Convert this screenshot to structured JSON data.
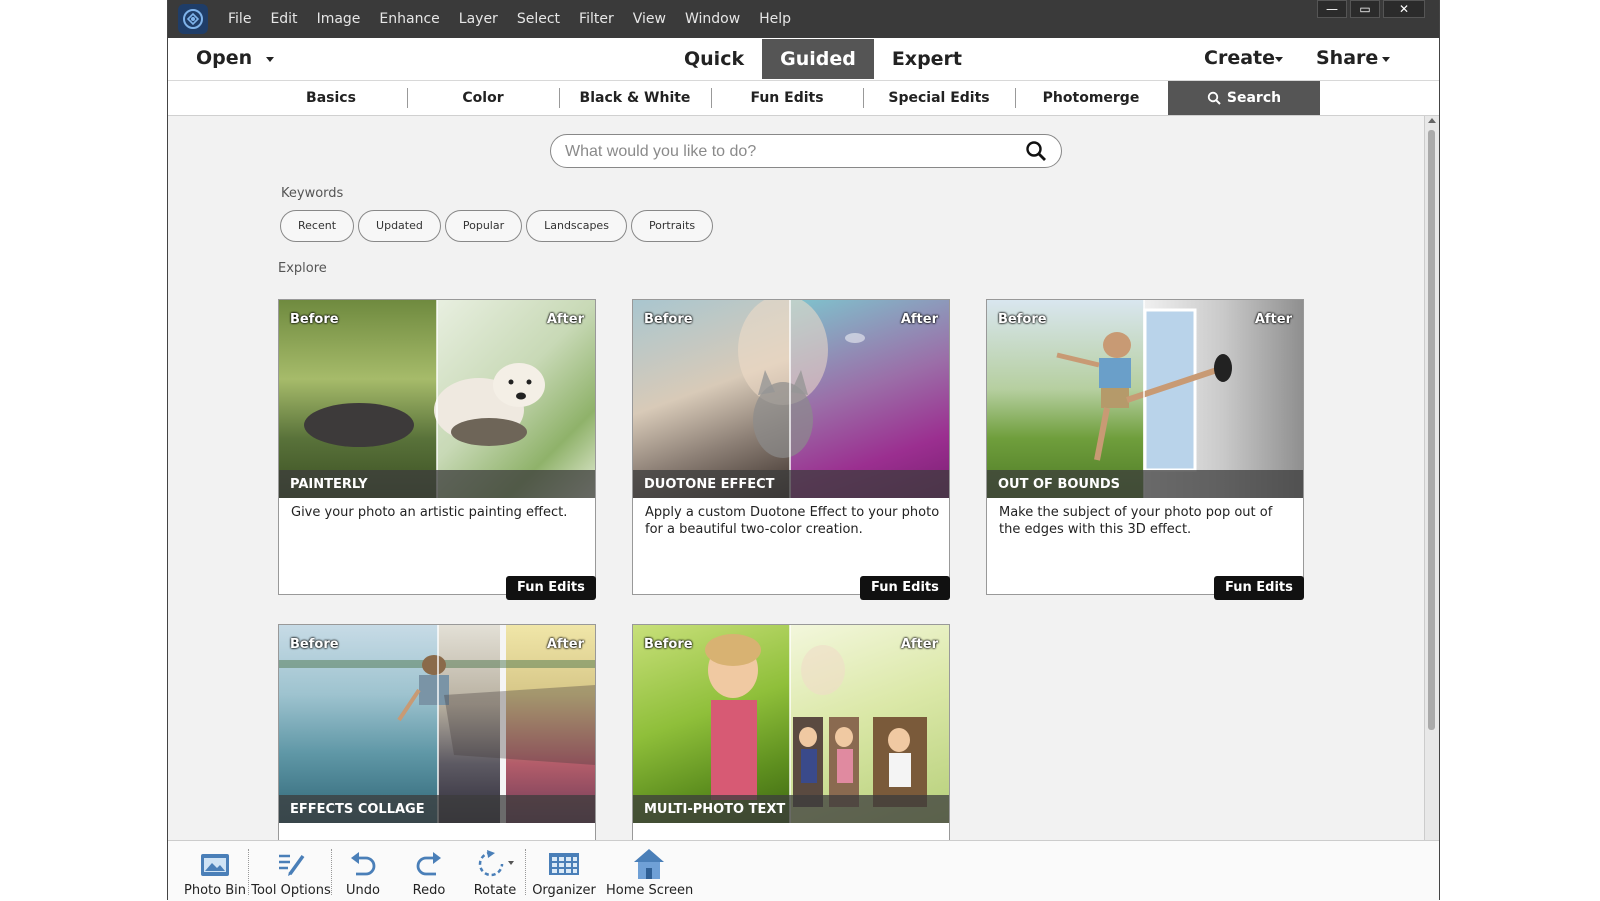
{
  "menu": {
    "items": [
      "File",
      "Edit",
      "Image",
      "Enhance",
      "Layer",
      "Select",
      "Filter",
      "View",
      "Window",
      "Help"
    ],
    "window_buttons": {
      "minimize": "—",
      "restore": "▭",
      "close": "✕"
    }
  },
  "modebar": {
    "open_label": "Open",
    "modes": [
      "Quick",
      "Guided",
      "Expert"
    ],
    "active_mode": "Guided",
    "create_label": "Create",
    "share_label": "Share"
  },
  "tabs": {
    "items": [
      "Basics",
      "Color",
      "Black & White",
      "Fun Edits",
      "Special Edits",
      "Photomerge"
    ],
    "search_label": "Search"
  },
  "search": {
    "placeholder": "What would you like to do?"
  },
  "keywords": {
    "label": "Keywords",
    "items": [
      "Recent",
      "Updated",
      "Popular",
      "Landscapes",
      "Portraits"
    ]
  },
  "explore": {
    "label": "Explore"
  },
  "cards": [
    {
      "before": "Before",
      "after": "After",
      "title": "PAINTERLY",
      "desc": "Give your photo an artistic painting effect.",
      "badge": "Fun Edits"
    },
    {
      "before": "Before",
      "after": "After",
      "title": "DUOTONE EFFECT",
      "desc": "Apply a custom Duotone Effect to your photo for a beautiful two-color creation.",
      "badge": "Fun Edits"
    },
    {
      "before": "Before",
      "after": "After",
      "title": "OUT OF BOUNDS",
      "desc": "Make the subject of your photo pop out of the edges with this 3D effect.",
      "badge": "Fun Edits"
    },
    {
      "before": "Before",
      "after": "After",
      "title": "EFFECTS COLLAGE"
    },
    {
      "before": "Before",
      "after": "After",
      "title": "MULTI-PHOTO TEXT"
    }
  ],
  "bottombar": {
    "tools": [
      "Photo Bin",
      "Tool Options",
      "Undo",
      "Redo",
      "Rotate",
      "Organizer",
      "Home Screen"
    ]
  },
  "colors": {
    "menubar_bg": "#3a3a3a",
    "active_mode_bg": "#555555",
    "badge_bg": "#111111",
    "icon_blue": "#4a7fb8"
  }
}
